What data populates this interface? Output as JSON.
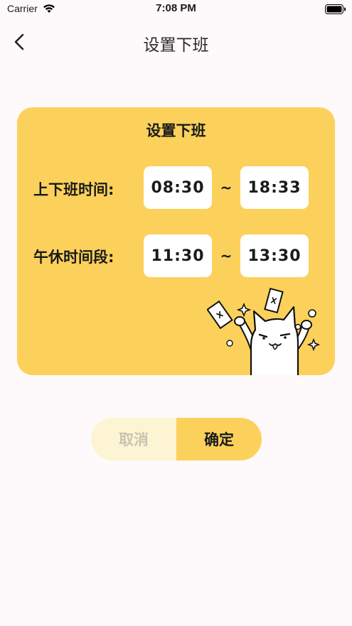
{
  "status_bar": {
    "carrier": "Carrier",
    "time": "7:08 PM"
  },
  "nav": {
    "title": "设置下班"
  },
  "card": {
    "title": "设置下班",
    "work_hours": {
      "label": "上下班时间:",
      "start": "08:30",
      "separator": "~",
      "end": "18:33"
    },
    "break_hours": {
      "label": "午休时间段:",
      "start": "11:30",
      "separator": "~",
      "end": "13:30"
    }
  },
  "actions": {
    "cancel_label": "取消",
    "confirm_label": "确定"
  },
  "colors": {
    "background": "#FEF9FA",
    "accent": "#FCD15B",
    "cancel_bg": "#FDF4D3",
    "cancel_text": "#C9C4B4"
  }
}
